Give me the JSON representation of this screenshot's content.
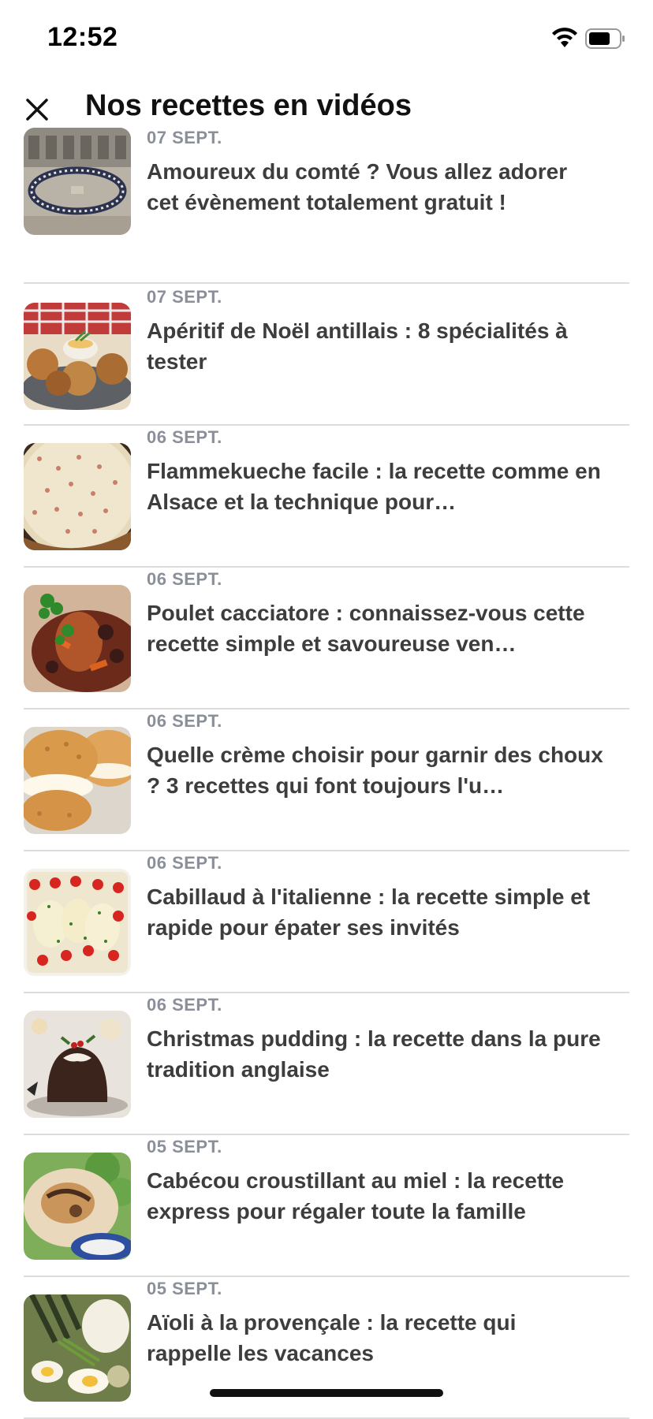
{
  "status_bar": {
    "time": "12:52"
  },
  "header": {
    "title": "Nos recettes en vidéos",
    "close_icon": "close-icon"
  },
  "articles": [
    {
      "date": "07 SEPT.",
      "title": "Amoureux du comté ? Vous allez adorer cet évènement totalement gratuit !",
      "thumb_icon": "event-photo"
    },
    {
      "date": "07 SEPT.",
      "title": "Apéritif de Noël antillais : 8 spécialités à tester",
      "thumb_icon": "accras-photo"
    },
    {
      "date": "06 SEPT.",
      "title": "Flammekueche facile : la recette comme en Alsace et la technique pour…",
      "thumb_icon": "flammekueche-photo"
    },
    {
      "date": "06 SEPT.",
      "title": "Poulet cacciatore : connaissez-vous cette recette simple et savoureuse ven…",
      "thumb_icon": "chicken-photo"
    },
    {
      "date": "06 SEPT.",
      "title": "Quelle crème choisir pour garnir des choux ? 3 recettes qui font toujours l'u…",
      "thumb_icon": "choux-photo"
    },
    {
      "date": "06 SEPT.",
      "title": "Cabillaud à l'italienne : la recette simple et rapide pour épater ses invités",
      "thumb_icon": "cod-photo"
    },
    {
      "date": "06 SEPT.",
      "title": "Christmas pudding : la recette dans la pure tradition anglaise",
      "thumb_icon": "pudding-photo"
    },
    {
      "date": "05 SEPT.",
      "title": "Cabécou croustillant au miel : la recette express pour régaler toute la famille",
      "thumb_icon": "cabecou-photo"
    },
    {
      "date": "05 SEPT.",
      "title": "Aïoli à la provençale : la recette qui rappelle les vacances",
      "thumb_icon": "aioli-photo"
    }
  ]
}
